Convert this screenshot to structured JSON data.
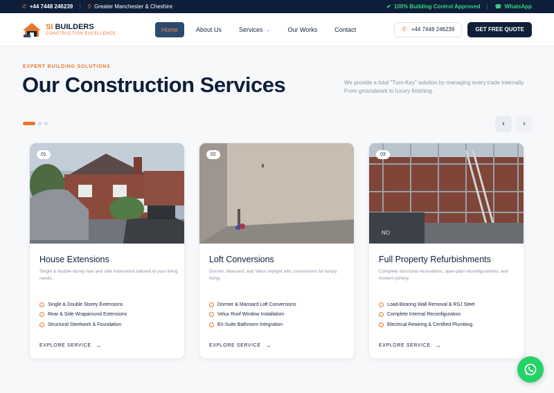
{
  "topbar": {
    "phone": "+44 7448 246239",
    "location": "Greater Manchester & Cheshire",
    "approval": "100% Building Control Approved",
    "whatsapp": "WhatsApp"
  },
  "header": {
    "logo": {
      "brand_accent": "SI",
      "brand_rest": " BUILDERS",
      "tagline": "CONSTRUCTION EXCELLENCE"
    },
    "nav": [
      {
        "label": "Home",
        "active": true
      },
      {
        "label": "About Us"
      },
      {
        "label": "Services",
        "has_dropdown": true
      },
      {
        "label": "Our Works"
      },
      {
        "label": "Contact"
      }
    ],
    "phone": "+44 7448 246239",
    "cta": "GET FREE QUOTE"
  },
  "hero": {
    "eyebrow": "EXPERT BUILDING SOLUTIONS",
    "title": "Our Construction Services",
    "description": "We provide a total \"Turn-Key\" solution by managing every trade internally. From groundwork to luxury finishing."
  },
  "slider": {
    "active_index": 0,
    "count": 3
  },
  "cards": [
    {
      "number": "01",
      "title": "House Extensions",
      "description": "Single & double-storey rear and side extensions tailored to your living needs.",
      "features": [
        "Single & Double Storey Extensions",
        "Rear & Side Wraparound Extensions",
        "Structural Steelwork & Foundation"
      ],
      "cta": "EXPLORE SERVICE"
    },
    {
      "number": "02",
      "title": "Loft Conversions",
      "description": "Dormer, Mansard, and Velux skylight attic conversions for luxury living.",
      "features": [
        "Dormer & Mansard Loft Conversions",
        "Velux Roof Window Installation",
        "En-Suite Bathroom Integration"
      ],
      "cta": "EXPLORE SERVICE"
    },
    {
      "number": "03",
      "title": "Full Property Refurbishments",
      "description": "Complete structural renovations, open-plan reconfigurations, and modern joinery.",
      "features": [
        "Load-Bearing Wall Removal & RSJ Steel",
        "Complete Internal Reconfiguration",
        "Electrical Rewiring & Certified Plumbing"
      ],
      "cta": "EXPLORE SERVICE"
    }
  ],
  "colors": {
    "navy": "#0f1f3a",
    "accent": "#e8762c",
    "green": "#25d366"
  },
  "icons": [
    "phone-icon",
    "location-icon",
    "shield-check-icon",
    "whatsapp-icon",
    "chevron-left-icon",
    "chevron-right-icon",
    "check-circle-icon",
    "arrow-right-icon"
  ]
}
